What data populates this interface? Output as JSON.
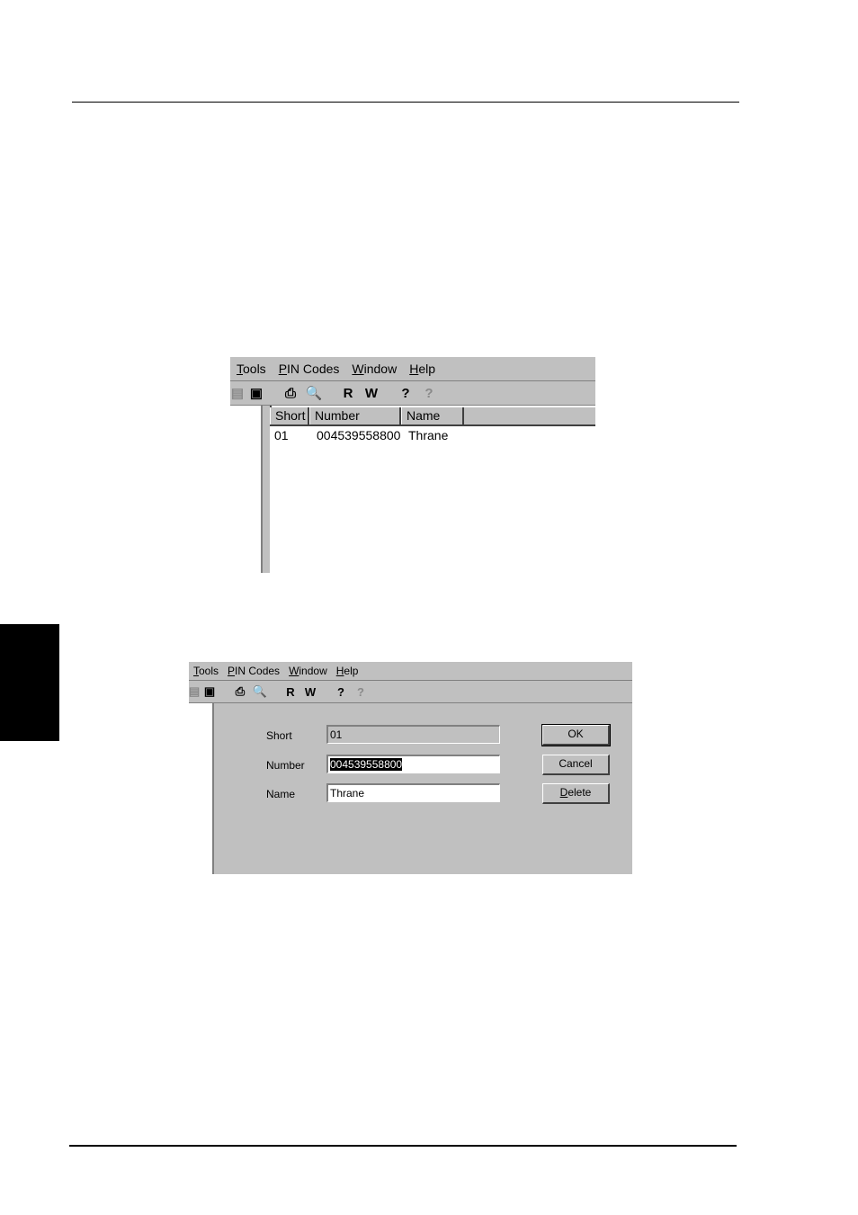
{
  "menu": [
    {
      "pre": "",
      "key": "T",
      "rest": "ools"
    },
    {
      "pre": "",
      "key": "P",
      "rest": "IN Codes"
    },
    {
      "pre": "",
      "key": "W",
      "rest": "indow"
    },
    {
      "pre": "",
      "key": "H",
      "rest": "elp"
    }
  ],
  "toolbar": {
    "read_label": "R",
    "write_label": "W",
    "help_label": "?",
    "context_help_label": "?"
  },
  "list_window": {
    "columns": [
      "Short",
      "Number",
      "Name"
    ],
    "rows": [
      {
        "short": "01",
        "number": "004539558800",
        "name": "Thrane"
      }
    ]
  },
  "edit_dialog": {
    "short_label": "Short",
    "number_label": "Number",
    "name_label": "Name",
    "short_value": "01",
    "number_value": "004539558800",
    "name_value": "Thrane",
    "ok_label": "OK",
    "cancel_label": "Cancel",
    "delete_key": "D",
    "delete_rest": "elete"
  }
}
